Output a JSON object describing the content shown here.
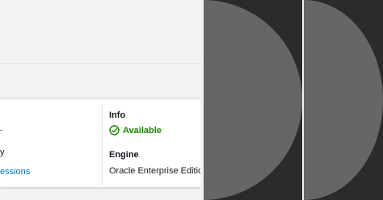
{
  "details": {
    "left_column": {
      "partial_label": "y",
      "partial_link": "essions"
    },
    "info": {
      "label": "Info",
      "status": "Available",
      "status_color": "#1d8102",
      "status_icon": "check-circle-icon"
    },
    "engine": {
      "label": "Engine",
      "value": "Oracle Enterprise Editio"
    }
  },
  "colors": {
    "link": "#0073bb",
    "panel_dark": "#2b2b2b",
    "circle_gray": "#666666"
  }
}
